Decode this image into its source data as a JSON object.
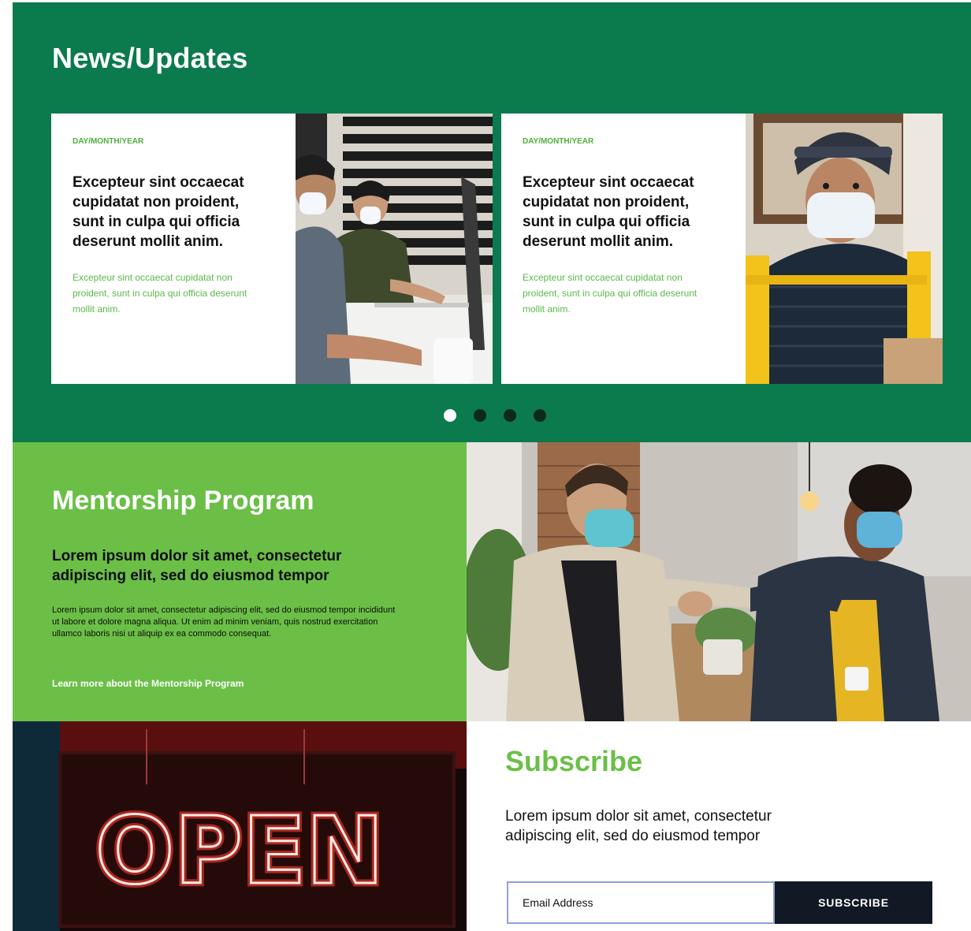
{
  "news": {
    "title": "News/Updates",
    "cards": [
      {
        "date": "DAY/MONTH/YEAR",
        "headline": "Excepteur sint occaecat cupidatat non proident, sunt in culpa qui officia deserunt mollit anim.",
        "excerpt": "Excepteur sint occaecat cupidatat non proident, sunt in culpa qui officia deserunt mollit anim."
      },
      {
        "date": "DAY/MONTH/YEAR",
        "headline": "Excepteur sint occaecat cupidatat non proident, sunt in culpa qui officia deserunt mollit anim.",
        "excerpt": "Excepteur sint occaecat cupidatat non proident, sunt in culpa qui officia deserunt mollit anim."
      }
    ],
    "carousel": {
      "total": 4,
      "active": 1
    }
  },
  "mentorship": {
    "title": "Mentorship Program",
    "subtitle": "Lorem ipsum dolor sit amet, consectetur adipiscing elit, sed do eiusmod tempor",
    "body": "Lorem ipsum dolor sit amet, consectetur adipiscing elit, sed do eiusmod tempor incididunt ut labore et dolore magna aliqua. Ut enim ad minim veniam, quis nostrud exercitation ullamco laboris nisi ut aliquip ex ea commodo consequat.",
    "link": "Learn more about the Mentorship Program"
  },
  "subscribe": {
    "title": "Subscribe",
    "text": "Lorem ipsum dolor sit amet, consectetur adipiscing elit, sed do eiusmod tempor",
    "placeholder": "Email Address",
    "button": "SUBSCRIBE"
  },
  "images": {
    "open_sign": "OPEN"
  },
  "colors": {
    "dark_green": "#0b7a4d",
    "light_green": "#6bbf47",
    "button_dark": "#111a24"
  }
}
